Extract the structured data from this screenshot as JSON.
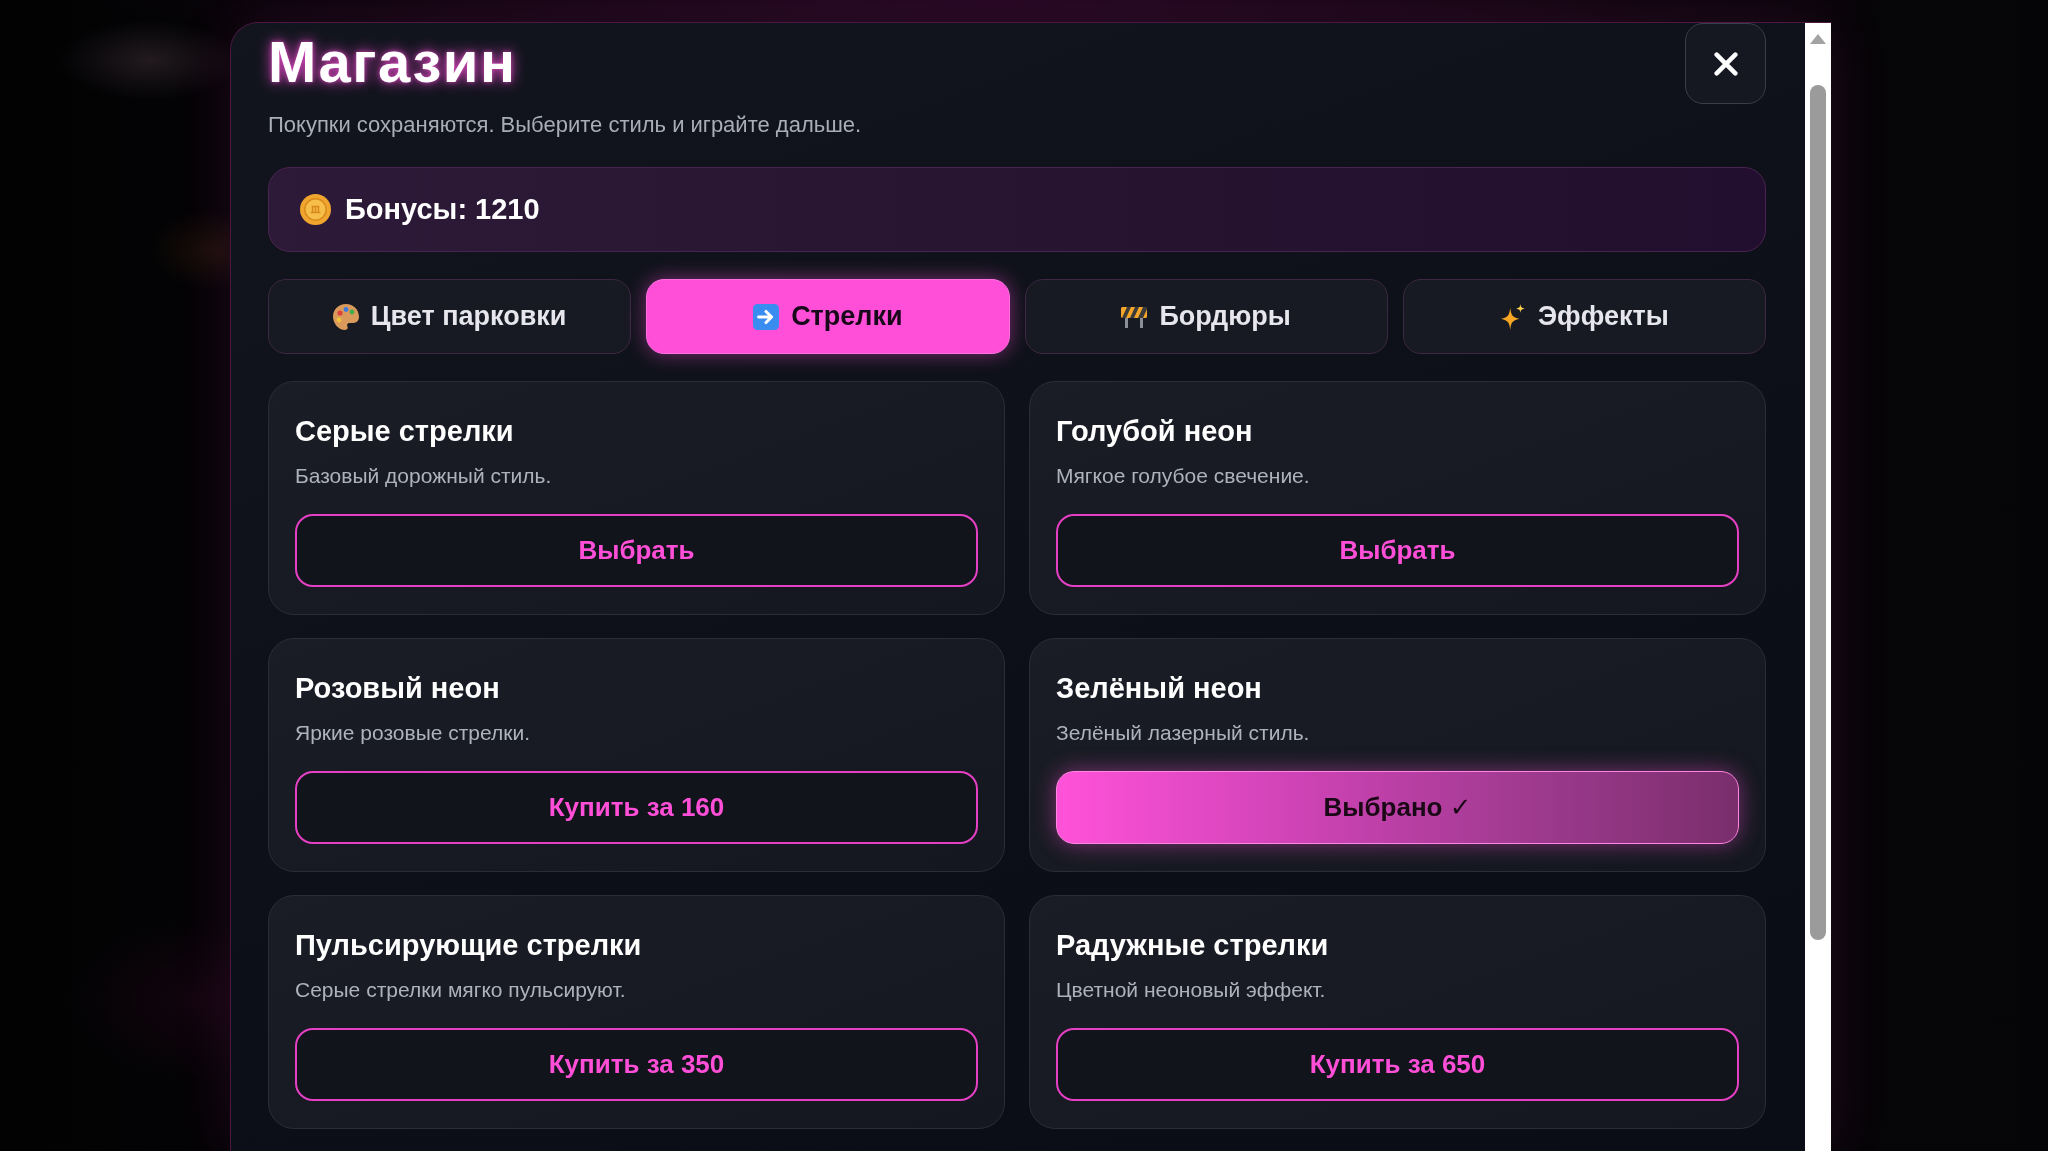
{
  "dialog": {
    "title": "Магазин",
    "subtitle": "Покупки сохраняются. Выберите стиль и играйте дальше.",
    "balance": "Бонусы: 1210"
  },
  "tabs": [
    {
      "label": "Цвет парковки",
      "selected": false
    },
    {
      "label": "Стрелки",
      "selected": true
    },
    {
      "label": "Бордюры",
      "selected": false
    },
    {
      "label": "Эффекты",
      "selected": false
    }
  ],
  "items": [
    {
      "title": "Серые стрелки",
      "description": "Базовый дорожный стиль.",
      "button": "Выбрать",
      "selected": false
    },
    {
      "title": "Голубой неон",
      "description": "Мягкое голубое свечение.",
      "button": "Выбрать",
      "selected": false
    },
    {
      "title": "Розовый неон",
      "description": "Яркие розовые стрелки.",
      "button": "Купить за 160",
      "selected": false
    },
    {
      "title": "Зелёный неон",
      "description": "Зелёный лазерный стиль.",
      "button": "Выбрано ✓",
      "selected": true
    },
    {
      "title": "Пульсирующие стрелки",
      "description": "Серые стрелки мягко пульсируют.",
      "button": "Купить за 350",
      "selected": false
    },
    {
      "title": "Радужные стрелки",
      "description": "Цветной неоновый эффект.",
      "button": "Купить за 650",
      "selected": false
    }
  ]
}
